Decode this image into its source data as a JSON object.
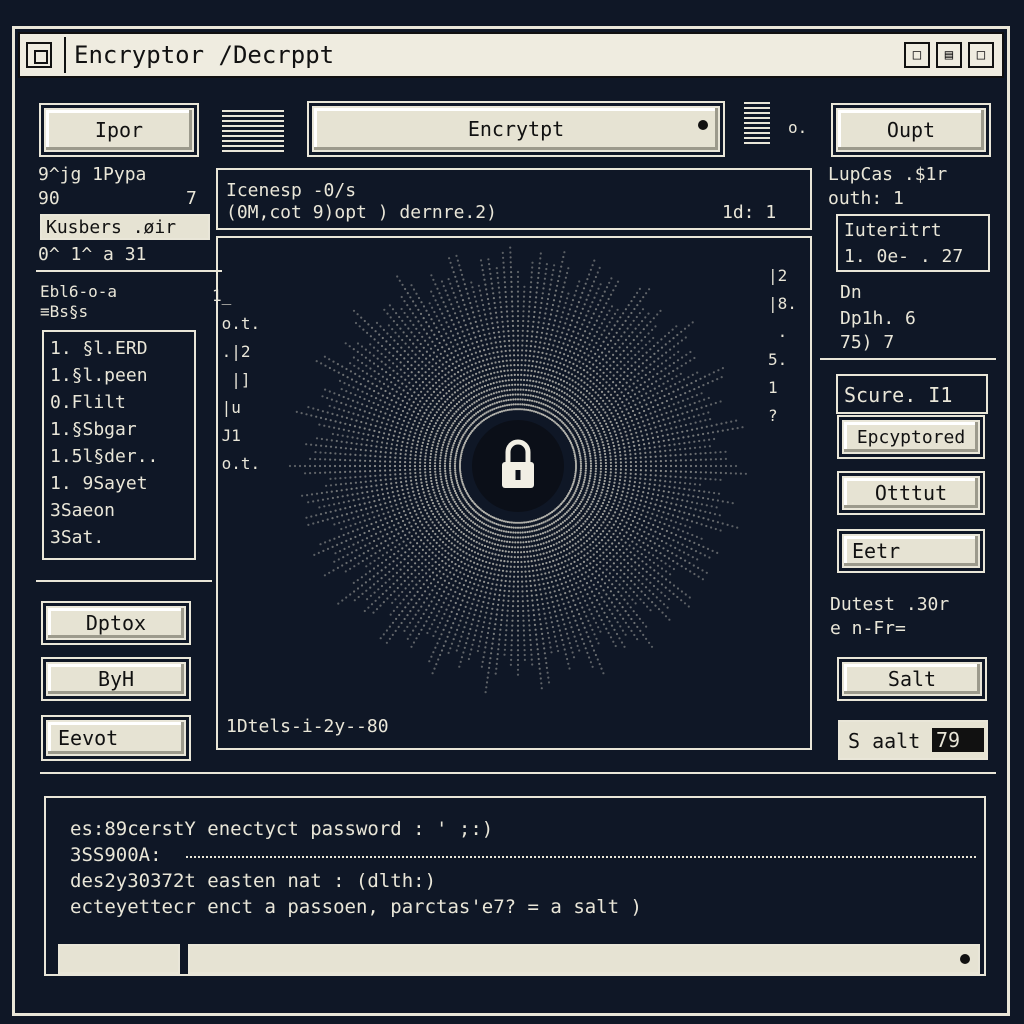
{
  "window": {
    "title": "Encryptor /Decrppt"
  },
  "toolbar": {
    "import_label": "Ipor",
    "encrypt_label": "Encrytpt",
    "output_label": "Oupt"
  },
  "left": {
    "line1": "9^jg 1Pypa",
    "line2": "90",
    "line2_num": "7",
    "users_label": "Kusbers .øir",
    "users_sub": "0^ 1^ a 31",
    "list_header1": "Ebl6-o-a",
    "list_header2": "≡Bs§s",
    "list_items": [
      "1. §l.ERD",
      "1.§l.peen",
      "0.Flilt",
      "1.§Sbgar",
      "1.5l§der..",
      "1.  9Sayet",
      "    3Saeon",
      "    3Sat."
    ],
    "btn_dptox": "Dptox",
    "btn_byh": "ByH",
    "btn_eevot": "Eevot"
  },
  "center": {
    "header_line1": "Icenesp -0/s",
    "header_line2": "(0M,cot  9)opt  )  dernre.2)",
    "header_right": "1d:  1",
    "footer_text": "1Dtels-i-2y--80",
    "lock_icon": "padlock"
  },
  "right": {
    "line1": "LupCas .$1r",
    "line2": "outh:  1",
    "box_line1": "Iuteritrt",
    "box_line2": "1. 0e- . 27",
    "on_label": "Dn",
    "on_line2": "Dp1h. 6",
    "on_line3": "75) 7",
    "secure_label": "Scure. I1",
    "btn_encrypted": "Epcyptored",
    "btn_otttut": "Otttut",
    "btn_eetr": "Eetr",
    "outest_line1": "Dutest .30r",
    "outest_line2": "e n-Fr=",
    "btn_salt": "Salt",
    "salt_field": "S aalt",
    "salt_num": "79"
  },
  "console": {
    "lines": [
      "es:89cerstY  enectyct password : ' ;:)",
      "3SS900A:",
      "des2y30372t  easten nat   :  (dlth:)",
      "ecteyettecr  enct a passoen, parctas'e7?  = a salt  )"
    ]
  },
  "colors": {
    "background": "#0f1726",
    "foreground": "#e9e6d8",
    "button": "#e6e3d3"
  }
}
